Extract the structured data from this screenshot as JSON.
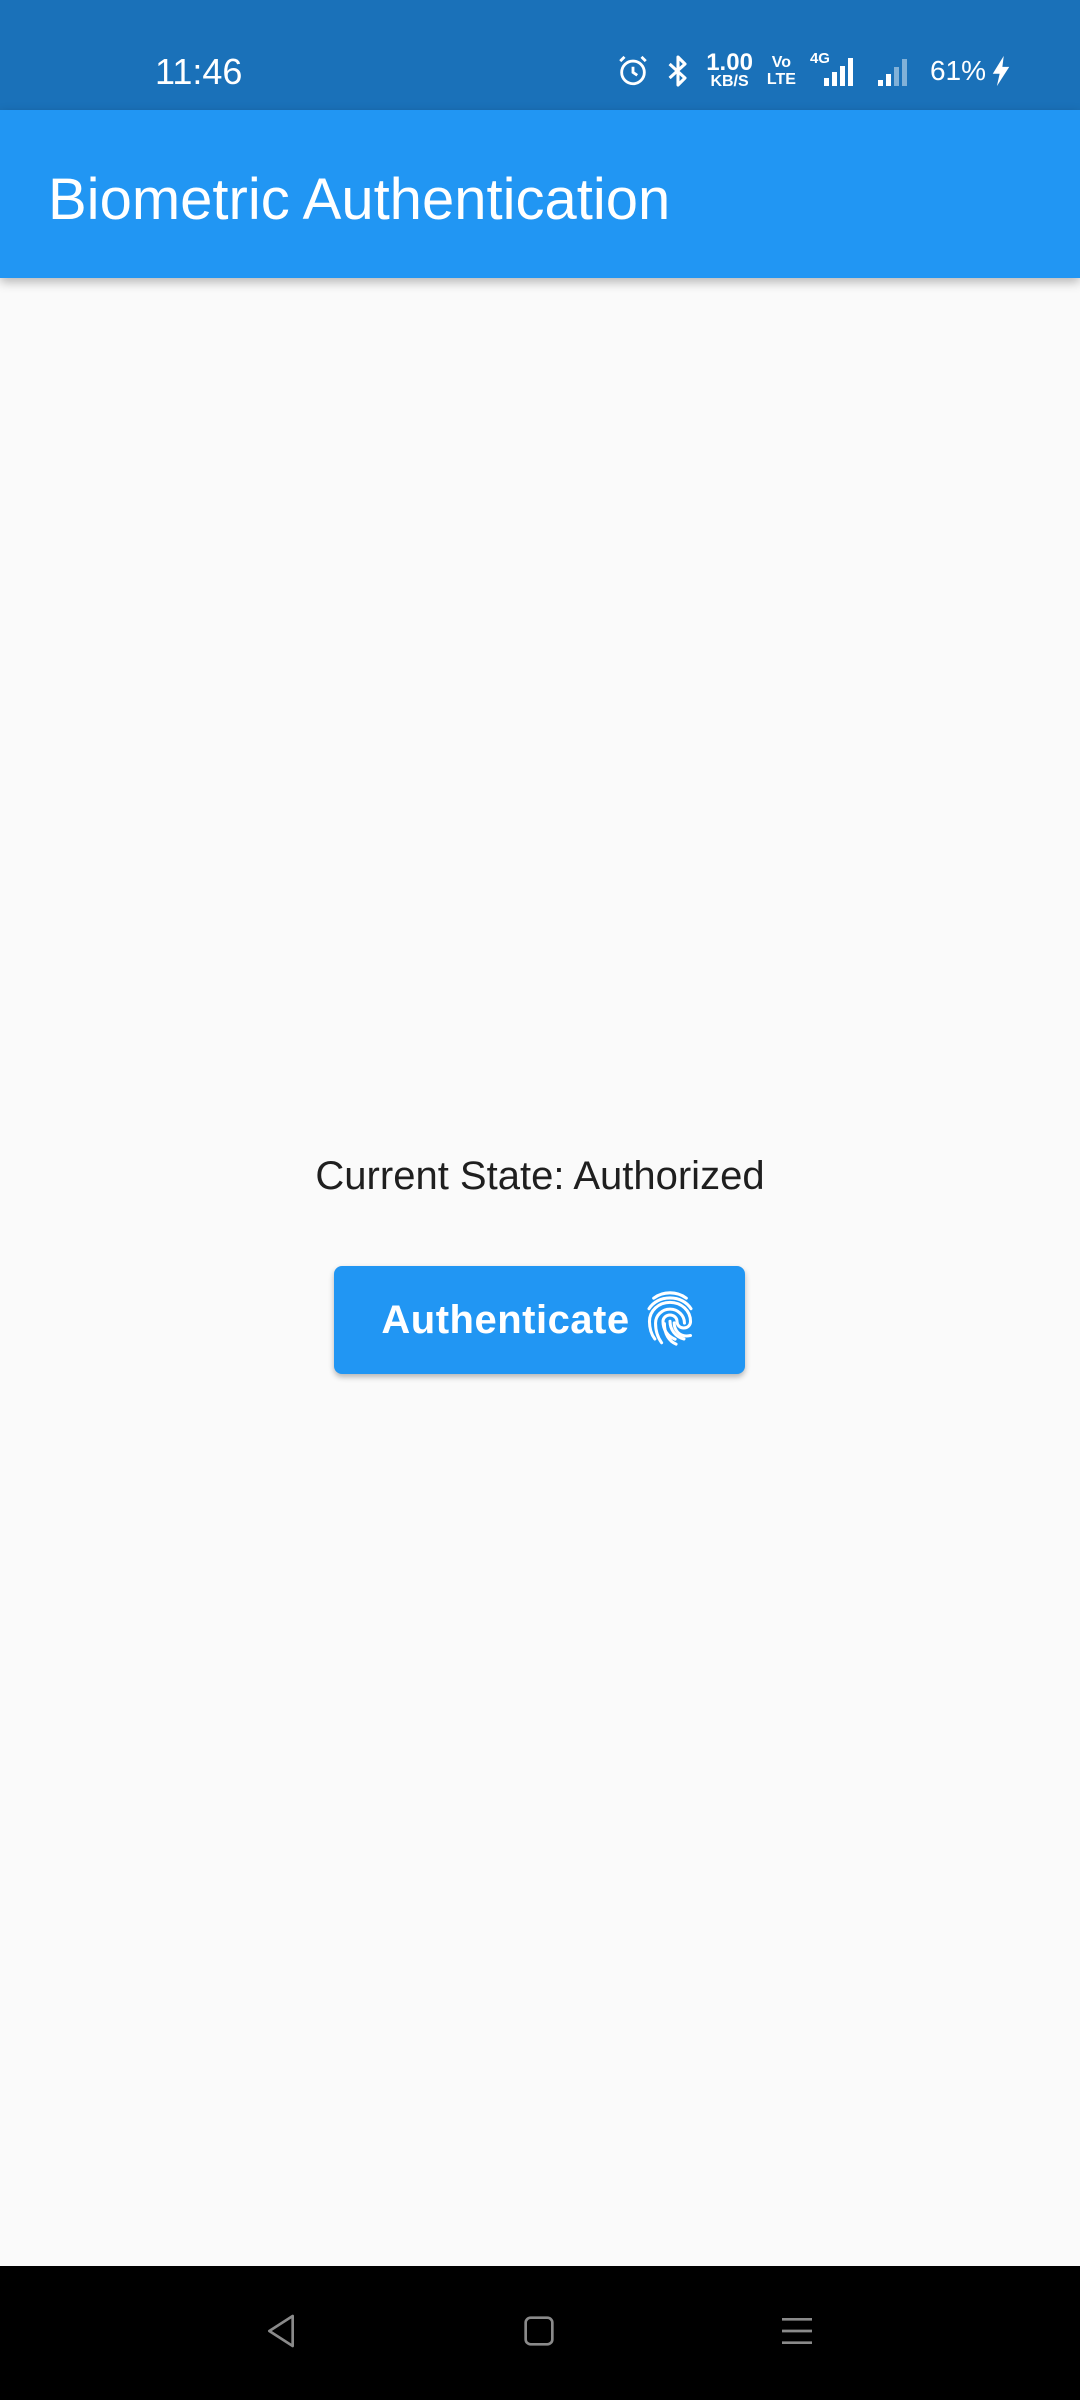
{
  "status_bar": {
    "time": "11:46",
    "network_speed": "1.00",
    "network_speed_unit": "KB/S",
    "volte_top": "Vo",
    "volte_bottom": "LTE",
    "network_type": "4G",
    "battery": "61%",
    "icons": [
      "alarm-icon",
      "bluetooth-icon",
      "signal-icon",
      "charging-icon"
    ]
  },
  "app_bar": {
    "title": "Biometric Authentication"
  },
  "main": {
    "state_text": "Current State: Authorized",
    "auth_button_label": "Authenticate",
    "auth_button_icon": "fingerprint-icon"
  },
  "nav_bar": {
    "buttons": [
      "back-icon",
      "home-icon",
      "menu-icon"
    ]
  },
  "colors": {
    "status_bar": "#1a71b9",
    "app_bar": "#2196f3",
    "button": "#2196f3",
    "background": "#fafafa",
    "nav_bar": "#000000"
  }
}
